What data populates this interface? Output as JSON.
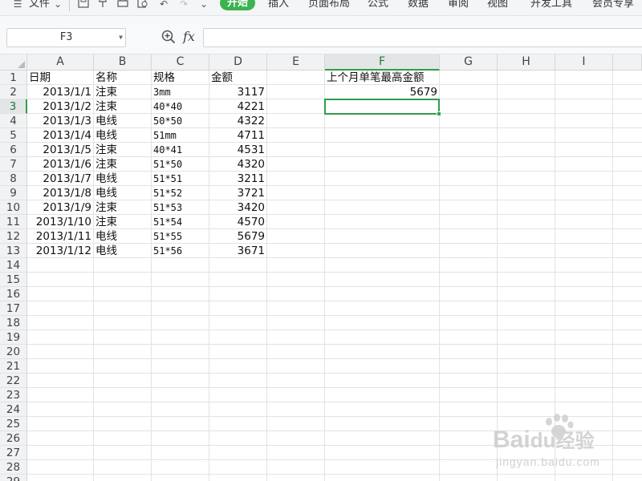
{
  "ribbon": {
    "menu_label": "文件",
    "tabs": [
      "开始",
      "插入",
      "页面布局",
      "公式",
      "数据",
      "审阅",
      "视图",
      "开发工具",
      "会员专享"
    ],
    "active_tab": "开始"
  },
  "formula_bar": {
    "name_box": "F3",
    "fx_label": "fx",
    "formula_value": ""
  },
  "columns": [
    "A",
    "B",
    "C",
    "D",
    "E",
    "F",
    "G",
    "H",
    "I"
  ],
  "rows": [
    "1",
    "2",
    "3",
    "4",
    "5",
    "6",
    "7",
    "8",
    "9",
    "10",
    "11",
    "12",
    "13",
    "14",
    "15",
    "16",
    "17",
    "18",
    "19",
    "20",
    "21",
    "22",
    "23",
    "24",
    "25",
    "26",
    "27",
    "28",
    "29"
  ],
  "active_cell": {
    "col": "F",
    "row": "3"
  },
  "sheet": {
    "headers": {
      "date": "日期",
      "name": "名称",
      "spec": "规格",
      "amount": "金额",
      "max_label": "上个月单笔最高金额"
    },
    "records": [
      {
        "date": "2013/1/1",
        "name": "注束",
        "spec": "3mm",
        "amount": "3117"
      },
      {
        "date": "2013/1/2",
        "name": "注束",
        "spec": "40*40",
        "amount": "4221"
      },
      {
        "date": "2013/1/3",
        "name": "电线",
        "spec": "50*50",
        "amount": "4322"
      },
      {
        "date": "2013/1/4",
        "name": "电线",
        "spec": "51mm",
        "amount": "4711"
      },
      {
        "date": "2013/1/5",
        "name": "注束",
        "spec": "40*41",
        "amount": "4531"
      },
      {
        "date": "2013/1/6",
        "name": "注束",
        "spec": "51*50",
        "amount": "4320"
      },
      {
        "date": "2013/1/7",
        "name": "电线",
        "spec": "51*51",
        "amount": "3211"
      },
      {
        "date": "2013/1/8",
        "name": "电线",
        "spec": "51*52",
        "amount": "3721"
      },
      {
        "date": "2013/1/9",
        "name": "注束",
        "spec": "51*53",
        "amount": "3420"
      },
      {
        "date": "2013/1/10",
        "name": "注束",
        "spec": "51*54",
        "amount": "4570"
      },
      {
        "date": "2013/1/11",
        "name": "电线",
        "spec": "51*55",
        "amount": "5679"
      },
      {
        "date": "2013/1/12",
        "name": "电线",
        "spec": "51*56",
        "amount": "3671"
      }
    ],
    "max_value": "5679"
  },
  "watermark": {
    "brand": "Bai",
    "brand_suffix": "经验",
    "url": "jingyan.baidu.com"
  },
  "colors": {
    "accent": "#3bb350",
    "selection": "#2f9f48",
    "header_bg": "#f1f2f3",
    "gridline": "#e1e2e4"
  }
}
